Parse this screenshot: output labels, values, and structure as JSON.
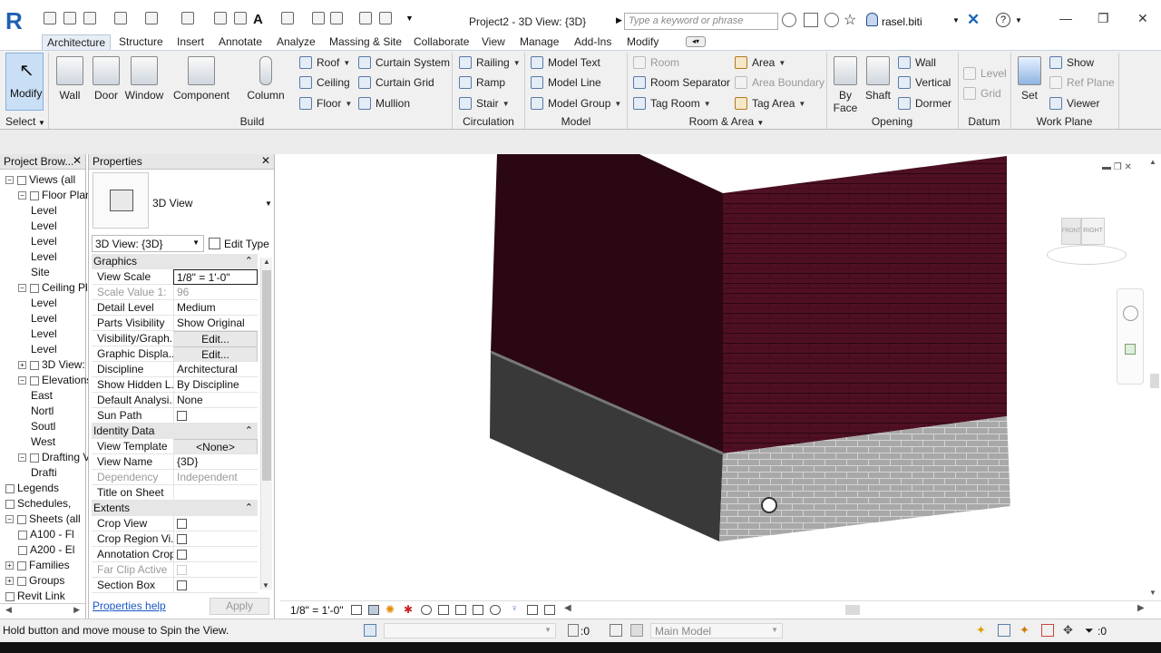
{
  "title_bar": {
    "document_title": "Project2 - 3D View: {3D}",
    "search_placeholder": "Type a keyword or phrase",
    "user": "rasel.biti"
  },
  "ribbon_tabs": [
    "Architecture",
    "Structure",
    "Insert",
    "Annotate",
    "Analyze",
    "Massing & Site",
    "Collaborate",
    "View",
    "Manage",
    "Add-Ins",
    "Modify"
  ],
  "ribbon": {
    "select": {
      "modify": "Modify",
      "panel": "Select"
    },
    "build": {
      "panel": "Build",
      "big": [
        "Wall",
        "Door",
        "Window",
        "Component",
        "Column"
      ],
      "small": [
        "Roof",
        "Ceiling",
        "Floor",
        "Curtain System",
        "Curtain Grid",
        "Mullion"
      ]
    },
    "circulation": {
      "panel": "Circulation",
      "items": [
        "Railing",
        "Ramp",
        "Stair"
      ]
    },
    "model": {
      "panel": "Model",
      "items": [
        "Model Text",
        "Model Line",
        "Model Group"
      ]
    },
    "room_area": {
      "panel": "Room & Area",
      "items": [
        "Room",
        "Room Separator",
        "Tag Room",
        "Area",
        "Area Boundary",
        "Tag Area"
      ]
    },
    "opening": {
      "panel": "Opening",
      "by_face_1": "By",
      "by_face_2": "Face",
      "shaft": "Shaft",
      "items": [
        "Wall",
        "Vertical",
        "Dormer"
      ]
    },
    "datum": {
      "panel": "Datum",
      "items": [
        "Level",
        "Grid"
      ]
    },
    "work_plane": {
      "panel": "Work Plane",
      "set": "Set",
      "items": [
        "Show",
        "Ref Plane",
        "Viewer"
      ]
    }
  },
  "project_browser": {
    "title": "Project Brow...",
    "items": [
      "Views (all",
      "Floor Plan",
      "Level",
      "Level",
      "Level",
      "Level",
      "Site",
      "Ceiling Pl",
      "Level",
      "Level",
      "Level",
      "Level",
      "3D View:",
      "Elevations",
      "East",
      "Nortl",
      "Soutl",
      "West",
      "Drafting V",
      "Drafti",
      "Legends",
      "Schedules,",
      "Sheets (all",
      "A100 - Fl",
      "A200 - El",
      "Families",
      "Groups",
      "Revit Link"
    ]
  },
  "properties": {
    "title": "Properties",
    "type_name": "3D View",
    "type_selector": "3D View: {3D}",
    "edit_type": "Edit Type",
    "groups": {
      "graphics": "Graphics",
      "identity": "Identity Data",
      "extents": "Extents"
    },
    "rows": [
      {
        "k": "View Scale",
        "v": "1/8\" = 1'-0\""
      },
      {
        "k": "Scale Value    1:",
        "v": "96"
      },
      {
        "k": "Detail Level",
        "v": "Medium"
      },
      {
        "k": "Parts Visibility",
        "v": "Show Original"
      },
      {
        "k": "Visibility/Graph...",
        "v": "Edit..."
      },
      {
        "k": "Graphic Displa...",
        "v": "Edit..."
      },
      {
        "k": "Discipline",
        "v": "Architectural"
      },
      {
        "k": "Show Hidden L...",
        "v": "By Discipline"
      },
      {
        "k": "Default Analysi...",
        "v": "None"
      },
      {
        "k": "Sun Path",
        "v": ""
      },
      {
        "k": "View Template",
        "v": "<None>"
      },
      {
        "k": "View Name",
        "v": "{3D}"
      },
      {
        "k": "Dependency",
        "v": "Independent"
      },
      {
        "k": "Title on Sheet",
        "v": ""
      },
      {
        "k": "Crop View",
        "v": ""
      },
      {
        "k": "Crop Region Vi...",
        "v": ""
      },
      {
        "k": "Annotation Crop",
        "v": ""
      },
      {
        "k": "Far Clip Active",
        "v": ""
      },
      {
        "k": "Section Box",
        "v": ""
      }
    ],
    "help": "Properties help",
    "apply": "Apply"
  },
  "view": {
    "scale": "1/8\" = 1'-0\"",
    "viewcube_front": "FRONT",
    "viewcube_right": "RIGHT",
    "colors": {
      "wall_dark": "#2a0712",
      "wall_brick": "#5a1426",
      "base_dark": "#3a3a3a",
      "base_brick": "#a9a9a9"
    }
  },
  "status": {
    "message": "Hold button and move mouse to Spin the View.",
    "worksets_count": ":0",
    "design_option": "Main Model",
    "filter_count": ":0"
  }
}
